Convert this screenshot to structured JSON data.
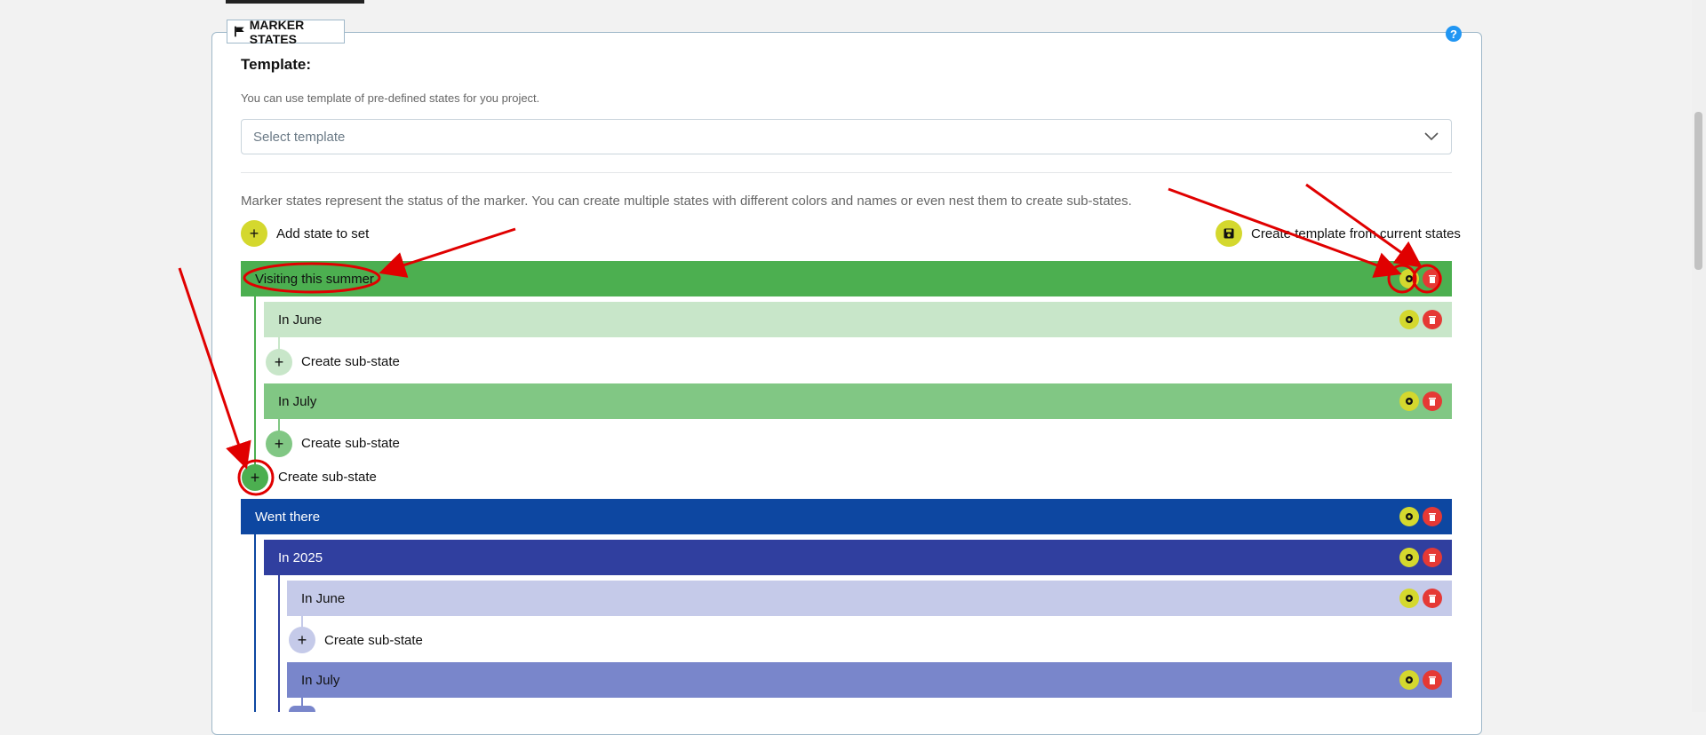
{
  "section": {
    "legend": "MARKER STATES",
    "help": "?"
  },
  "template": {
    "heading": "Template:",
    "hint": "You can use template of pre-defined states for you project.",
    "select_placeholder": "Select template"
  },
  "description": "Marker states represent the status of the marker. You can create multiple states with different colors and names or even nest them to create sub-states.",
  "actions": {
    "add_state": "Add state to set",
    "create_template": "Create template from current states",
    "create_sub_state": "Create sub-state"
  },
  "states": [
    {
      "name": "Visiting this summer",
      "color": "#4caf50"
    },
    {
      "name": "In June",
      "color": "#c8e6c9"
    },
    {
      "name": "In July",
      "color": "#81c784"
    },
    {
      "name": "Went there",
      "color": "#0d47a1"
    },
    {
      "name": "In 2025",
      "color": "#303f9f"
    },
    {
      "name": "In June",
      "color": "#c5cae9"
    },
    {
      "name": "In July",
      "color": "#7986cb"
    }
  ],
  "colors": {
    "accent_yellow": "#d4d82e",
    "delete_red": "#e53935",
    "annotation_red": "#e00000"
  }
}
